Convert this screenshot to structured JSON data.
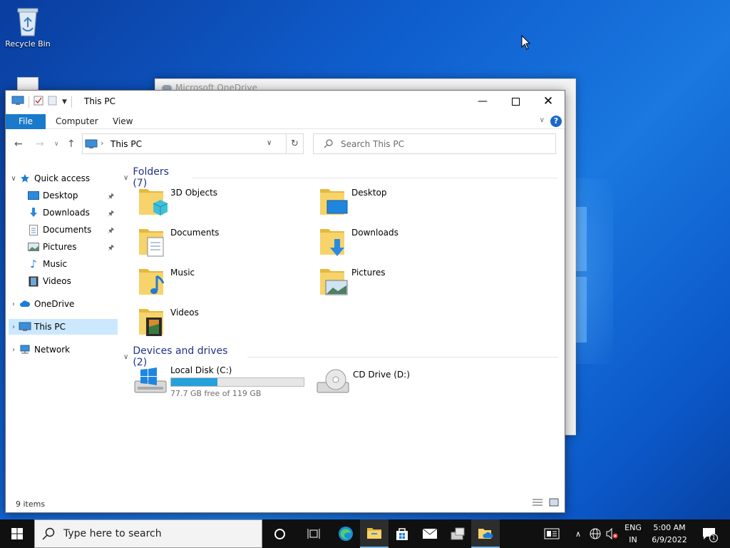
{
  "desktop": {
    "recycle_bin_label": "Recycle Bin"
  },
  "background_window": {
    "title": "Microsoft OneDrive"
  },
  "explorer": {
    "title": "This PC",
    "ribbon_tabs": {
      "file": "File",
      "computer": "Computer",
      "view": "View"
    },
    "address": {
      "crumb": "This PC"
    },
    "search": {
      "placeholder": "Search This PC"
    },
    "sidebar": {
      "quick_access": "Quick access",
      "desktop": "Desktop",
      "downloads": "Downloads",
      "documents": "Documents",
      "pictures": "Pictures",
      "music": "Music",
      "videos": "Videos",
      "onedrive": "OneDrive",
      "this_pc": "This PC",
      "network": "Network"
    },
    "folders_group": "Folders (7)",
    "folders": {
      "objects3d": "3D Objects",
      "desktop": "Desktop",
      "documents": "Documents",
      "downloads": "Downloads",
      "music": "Music",
      "pictures": "Pictures",
      "videos": "Videos"
    },
    "drives_group": "Devices and drives (2)",
    "drives": {
      "c_name": "Local Disk (C:)",
      "c_free": "77.7 GB free of 119 GB",
      "c_used_fraction": 0.347,
      "d_name": "CD Drive (D:)"
    },
    "status": "9 items"
  },
  "taskbar": {
    "search_text": "Type here to search",
    "lang_line1": "ENG",
    "lang_line2": "IN",
    "time": "5:00 AM",
    "date": "6/9/2022",
    "notification_count": "1"
  },
  "colors": {
    "accent": "#1979ca",
    "selection": "#cce8ff",
    "folder_yellow": "#f2c94c",
    "drive_bar": "#26a0da"
  }
}
